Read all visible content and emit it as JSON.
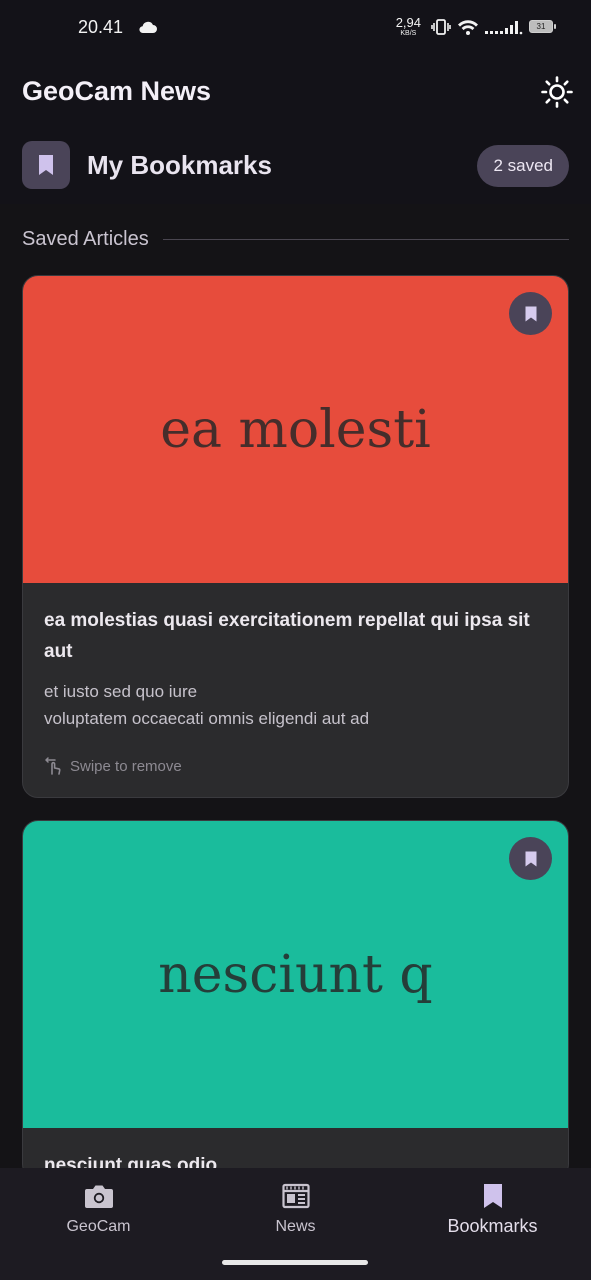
{
  "status_bar": {
    "time": "20.41",
    "net_speed_value": "2,94",
    "net_speed_unit": "KB/S",
    "battery_level": "31",
    "icons": [
      "cloud-icon",
      "vibrate-icon",
      "wifi-icon",
      "signal-icon",
      "battery-icon"
    ]
  },
  "app_bar": {
    "title": "GeoCam News",
    "theme_toggle_icon": "sun-icon"
  },
  "bookmarks_header": {
    "title": "My Bookmarks",
    "icon": "bookmark-icon",
    "saved_count_label": "2 saved"
  },
  "section": {
    "label": "Saved Articles"
  },
  "articles": [
    {
      "image_text": "ea molesti",
      "image_color": "#e74c3c",
      "title": "ea molestias quasi exercitationem repellat qui ipsa sit aut",
      "description_line1": "et iusto sed quo iure",
      "description_line2": "voluptatem occaecati omnis eligendi aut ad",
      "swipe_hint": "Swipe to remove",
      "bookmarked": true
    },
    {
      "image_text": "nesciunt q",
      "image_color": "#1abc9c",
      "title": "nesciunt quas odio",
      "bookmarked": true
    }
  ],
  "bottom_nav": {
    "items": [
      {
        "label": "GeoCam",
        "icon": "camera-icon",
        "active": false
      },
      {
        "label": "News",
        "icon": "newspaper-icon",
        "active": false
      },
      {
        "label": "Bookmarks",
        "icon": "bookmark-icon",
        "active": true
      }
    ]
  },
  "colors": {
    "background": "#141316",
    "surface": "#131218",
    "card": "#2b2b2d",
    "accent_container": "#4a4458",
    "accent_icon": "#cfc2ec",
    "nav_background": "#1d1b22"
  }
}
